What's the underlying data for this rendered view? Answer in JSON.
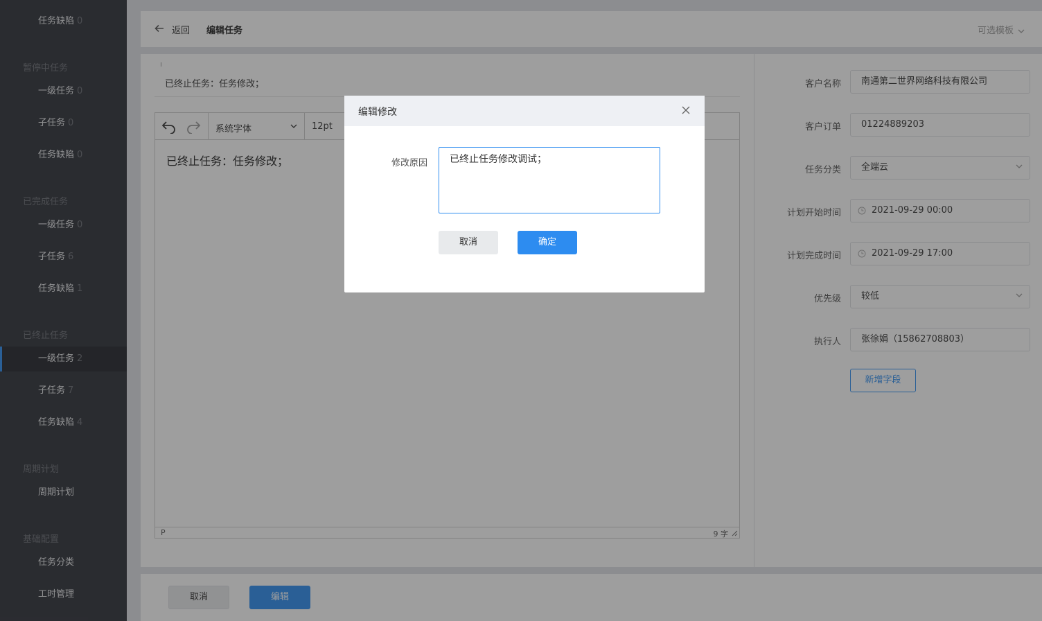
{
  "sidebar": {
    "top_item": {
      "label": "任务缺陷",
      "count": "0"
    },
    "groups": [
      {
        "title": "暂停中任务",
        "items": [
          {
            "label": "一级任务",
            "count": "0"
          },
          {
            "label": "子任务",
            "count": "0"
          },
          {
            "label": "任务缺陷",
            "count": "0"
          }
        ]
      },
      {
        "title": "已完成任务",
        "items": [
          {
            "label": "一级任务",
            "count": "0"
          },
          {
            "label": "子任务",
            "count": "6"
          },
          {
            "label": "任务缺陷",
            "count": "1"
          }
        ]
      },
      {
        "title": "已终止任务",
        "items": [
          {
            "label": "一级任务",
            "count": "2"
          },
          {
            "label": "子任务",
            "count": "7"
          },
          {
            "label": "任务缺陷",
            "count": "4"
          }
        ]
      },
      {
        "title": "周期计划",
        "items": [
          {
            "label": "周期计划",
            "count": ""
          }
        ]
      },
      {
        "title": "基础配置",
        "items": [
          {
            "label": "任务分类",
            "count": ""
          },
          {
            "label": "工时管理",
            "count": ""
          }
        ]
      }
    ]
  },
  "header": {
    "back_label": "返回",
    "title": "编辑任务",
    "template_label": "可选模板"
  },
  "summary": "已终止任务：任务修改；",
  "editor": {
    "font_family": "系统字体",
    "font_size": "12pt",
    "content": "已终止任务：任务修改；",
    "path": "P",
    "word_count": "9 字"
  },
  "form": {
    "customer_name": {
      "label": "客户名称",
      "value": "南通第二世界网络科技有限公司"
    },
    "customer_order": {
      "label": "客户订单",
      "value": "01224889203"
    },
    "category": {
      "label": "任务分类",
      "value": "全端云"
    },
    "plan_start": {
      "label": "计划开始时间",
      "value": "2021-09-29 00:00"
    },
    "plan_end": {
      "label": "计划完成时间",
      "value": "2021-09-29 17:00"
    },
    "priority": {
      "label": "优先级",
      "value": "较低"
    },
    "executor": {
      "label": "执行人",
      "value": "张徐娟（15862708803）"
    },
    "add_field_label": "新增字段"
  },
  "footer": {
    "cancel_label": "取消",
    "edit_label": "编辑"
  },
  "modal": {
    "title": "编辑修改",
    "reason_label": "修改原因",
    "reason_value": "已终止任务修改调试；",
    "cancel_label": "取消",
    "ok_label": "确定"
  },
  "colors": {
    "primary": "#2d8cf0",
    "sidebar_bg": "#2d3038"
  }
}
